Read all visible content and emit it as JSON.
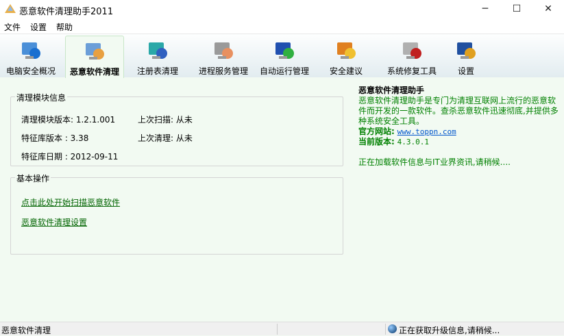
{
  "window": {
    "title": "恶意软件清理助手2011",
    "minimize": "─",
    "maximize": "☐",
    "close": "✕"
  },
  "menu": [
    "文件",
    "设置",
    "帮助"
  ],
  "toolbar": [
    {
      "label": "电脑安全概况",
      "icon": "computer-info-icon"
    },
    {
      "label": "恶意软件清理",
      "icon": "computer-broom-icon",
      "active": true
    },
    {
      "label": "注册表清理",
      "icon": "registry-icon"
    },
    {
      "label": "进程服务管理",
      "icon": "gears-icon"
    },
    {
      "label": "自动运行管理",
      "icon": "startup-icon"
    },
    {
      "label": "安全建议",
      "icon": "advisor-icon"
    },
    {
      "label": "系统修复工具",
      "icon": "repair-tools-icon"
    },
    {
      "label": "设置",
      "icon": "settings-check-icon"
    }
  ],
  "module_info": {
    "title": "清理模块信息",
    "module_version": "清理模块版本: 1.2.1.001",
    "last_scan": "上次扫描: 从未",
    "sig_version": "特征库版本  : 3.38",
    "last_clean": "上次清理: 从未",
    "sig_date": "特征库日期  : 2012-09-11"
  },
  "basic_ops": {
    "title": "基本操作",
    "scan_link": "点击此处开始扫描恶意软件",
    "settings_link": "恶意软件清理设置"
  },
  "about": {
    "heading": "恶意软件清理助手",
    "desc": "恶意软件清理助手是专门为清理互联网上流行的恶意软件而开发的一款软件。查杀恶意软件迅速彻底,并提供多种系统安全工具。",
    "site_label": "官方网站:",
    "site": "www.toppn.com",
    "ver_label": "当前版本:",
    "ver": "4.3.0.1",
    "loading": "正在加载软件信息与IT业界资讯,请稍候...."
  },
  "status": {
    "left": "恶意软件清理",
    "right": "正在获取升级信息,请稍候..."
  },
  "colors": {
    "bg": "#f2faf2",
    "green": "#008000",
    "link": "#0055cc"
  }
}
